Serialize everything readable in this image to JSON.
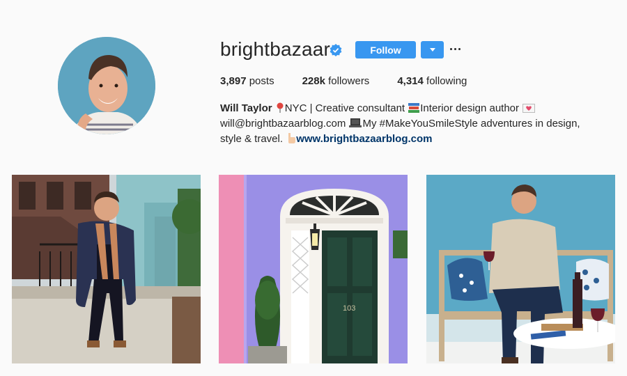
{
  "profile": {
    "username": "brightbazaar",
    "follow_label": "Follow",
    "stats": {
      "posts_count": "3,897",
      "posts_label": "posts",
      "followers_count": "228k",
      "followers_label": "followers",
      "following_count": "4,314",
      "following_label": "following"
    },
    "bio": {
      "name": "Will Taylor",
      "line1_rest": "NYC | Creative consultant",
      "line1_tail": "Interior design author",
      "line2_email": "will@brightbazaarblog.com",
      "line2_rest": "My #MakeYouSmileStyle adventures in design,",
      "line3_start": "style & travel.",
      "website": "www.brightbazaarblog.com"
    },
    "door_number": "103"
  },
  "colors": {
    "accent": "#3897f0",
    "link": "#003569",
    "text": "#262626",
    "background": "#fafafa"
  },
  "icons": [
    "verified-badge-icon",
    "chevron-down-icon",
    "more-options-icon",
    "pin-icon",
    "books-icon",
    "heart-letter-icon",
    "laptop-icon",
    "pointing-hand-icon"
  ]
}
